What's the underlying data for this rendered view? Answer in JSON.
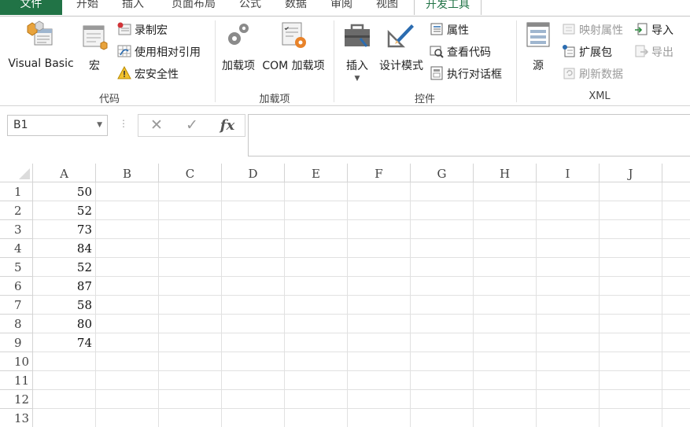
{
  "tabs": {
    "file": "文件",
    "home": "开始",
    "insert": "插入",
    "page_layout": "页面布局",
    "formulas": "公式",
    "data": "数据",
    "review": "审阅",
    "view": "视图",
    "developer": "开发工具"
  },
  "ribbon": {
    "code_group": {
      "label": "代码",
      "visual_basic": "Visual Basic",
      "macros": "宏",
      "record_macro": "录制宏",
      "use_relative_refs": "使用相对引用",
      "macro_security": "宏安全性"
    },
    "addins_group": {
      "label": "加载项",
      "addins": "加载项",
      "com_addins": "COM 加载项"
    },
    "controls_group": {
      "label": "控件",
      "insert": "插入",
      "design_mode": "设计模式",
      "properties": "属性",
      "view_code": "查看代码",
      "run_dialog": "执行对话框"
    },
    "xml_group": {
      "label": "XML",
      "source": "源",
      "map_properties": "映射属性",
      "expansion_packs": "扩展包",
      "refresh_data": "刷新数据",
      "import": "导入",
      "export": "导出"
    }
  },
  "formula_bar": {
    "name_box": "B1",
    "fx": "fx",
    "formula": ""
  },
  "sheet": {
    "columns": [
      "A",
      "B",
      "C",
      "D",
      "E",
      "F",
      "G",
      "H",
      "I",
      "J"
    ],
    "rows": [
      "1",
      "2",
      "3",
      "4",
      "5",
      "6",
      "7",
      "8",
      "9",
      "10",
      "11",
      "12",
      "13"
    ],
    "column_a_values": [
      "50",
      "52",
      "73",
      "84",
      "52",
      "87",
      "58",
      "80",
      "74",
      "",
      "",
      "",
      ""
    ]
  },
  "colors": {
    "file_tab": "#217346",
    "active_tab_text": "#217346",
    "gridline": "#e1e1e1",
    "header_border": "#d4d4d4"
  }
}
